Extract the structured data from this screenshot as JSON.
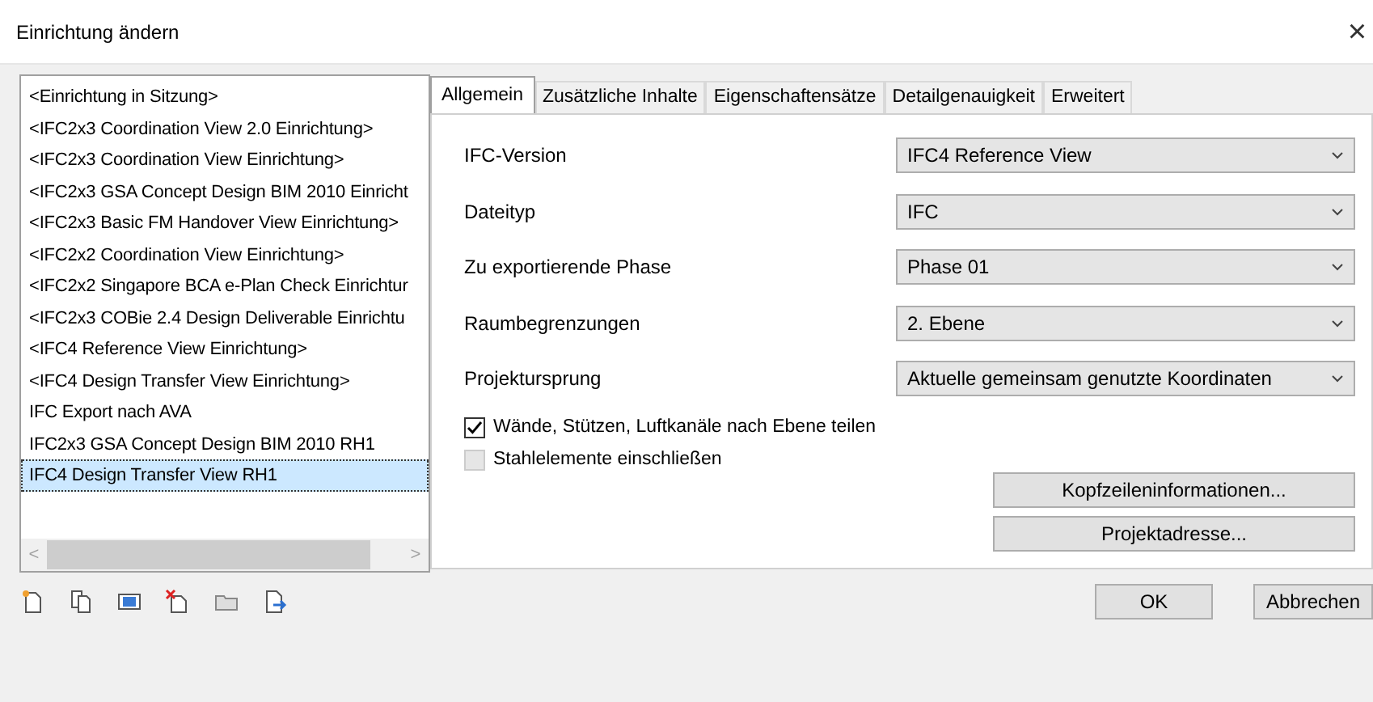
{
  "window": {
    "title": "Einrichtung ändern",
    "close": "×"
  },
  "setups": [
    {
      "label": "<Einrichtung in Sitzung>",
      "selected": false
    },
    {
      "label": "<IFC2x3 Coordination View 2.0 Einrichtung>",
      "selected": false
    },
    {
      "label": "<IFC2x3 Coordination View Einrichtung>",
      "selected": false
    },
    {
      "label": "<IFC2x3 GSA Concept Design BIM 2010 Einricht",
      "selected": false
    },
    {
      "label": "<IFC2x3 Basic FM Handover View Einrichtung>",
      "selected": false
    },
    {
      "label": "<IFC2x2 Coordination View Einrichtung>",
      "selected": false
    },
    {
      "label": "<IFC2x2 Singapore BCA e-Plan Check Einrichtur",
      "selected": false
    },
    {
      "label": "<IFC2x3 COBie 2.4 Design Deliverable Einrichtu",
      "selected": false
    },
    {
      "label": "<IFC4 Reference View Einrichtung>",
      "selected": false
    },
    {
      "label": "<IFC4 Design Transfer View Einrichtung>",
      "selected": false
    },
    {
      "label": "IFC Export nach AVA",
      "selected": false
    },
    {
      "label": "IFC2x3 GSA Concept Design BIM 2010 RH1",
      "selected": false
    },
    {
      "label": "IFC4 Design Transfer View RH1",
      "selected": true
    }
  ],
  "scrollbar": {
    "left": "<",
    "right": ">"
  },
  "toolbar": [
    {
      "kind": "new"
    },
    {
      "kind": "duplicate"
    },
    {
      "kind": "rename"
    },
    {
      "kind": "delete"
    },
    {
      "kind": "open"
    },
    {
      "kind": "export"
    }
  ],
  "tabs": [
    {
      "label": "Allgemein",
      "selected": true
    },
    {
      "label": "Zusätzliche Inhalte",
      "selected": false
    },
    {
      "label": "Eigenschaftensätze",
      "selected": false
    },
    {
      "label": "Detailgenauigkeit",
      "selected": false
    },
    {
      "label": "Erweitert",
      "selected": false
    }
  ],
  "fields": [
    {
      "label": "IFC-Version",
      "value": "IFC4 Reference View"
    },
    {
      "label": "Dateityp",
      "value": "IFC"
    },
    {
      "label": "Zu exportierende Phase",
      "value": "Phase 01"
    },
    {
      "label": "Raumbegrenzungen",
      "value": "2. Ebene"
    },
    {
      "label": "Projektursprung",
      "value": "Aktuelle gemeinsam genutzte Koordinaten"
    }
  ],
  "checkboxes": [
    {
      "label": "Wände, Stützen, Luftkanäle nach Ebene teilen",
      "checked": true,
      "disabled": false
    },
    {
      "label": "Stahlelemente einschließen",
      "checked": false,
      "disabled": true
    }
  ],
  "panel_buttons": [
    "Kopfzeileninformationen...",
    "Projektadresse..."
  ],
  "buttons": [
    "OK",
    "Abbrechen"
  ]
}
